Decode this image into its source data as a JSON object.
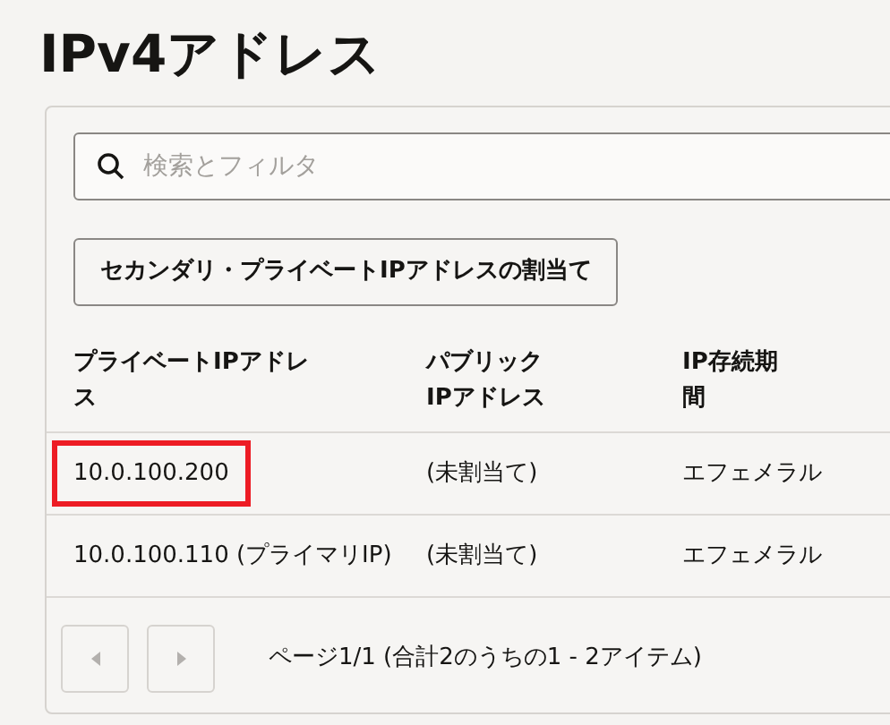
{
  "title": "IPv4アドレス",
  "search": {
    "placeholder": "検索とフィルタ"
  },
  "assign_button": "セカンダリ・プライベートIPアドレスの割当て",
  "table": {
    "columns": [
      "プライベートIPアドレス",
      "パブリックIPアドレス",
      "IP存続期間"
    ],
    "rows": [
      {
        "cells": [
          "10.0.100.200",
          "(未割当て)",
          "エフェメラル"
        ],
        "highlighted": true
      },
      {
        "cells": [
          "10.0.100.110 (プライマリIP)",
          "(未割当て)",
          "エフェメラル"
        ],
        "highlighted": false
      }
    ]
  },
  "pagination": {
    "prev_disabled": true,
    "next_disabled": true,
    "text": "ページ1/1 (合計2のうちの1 - 2アイテム)"
  }
}
